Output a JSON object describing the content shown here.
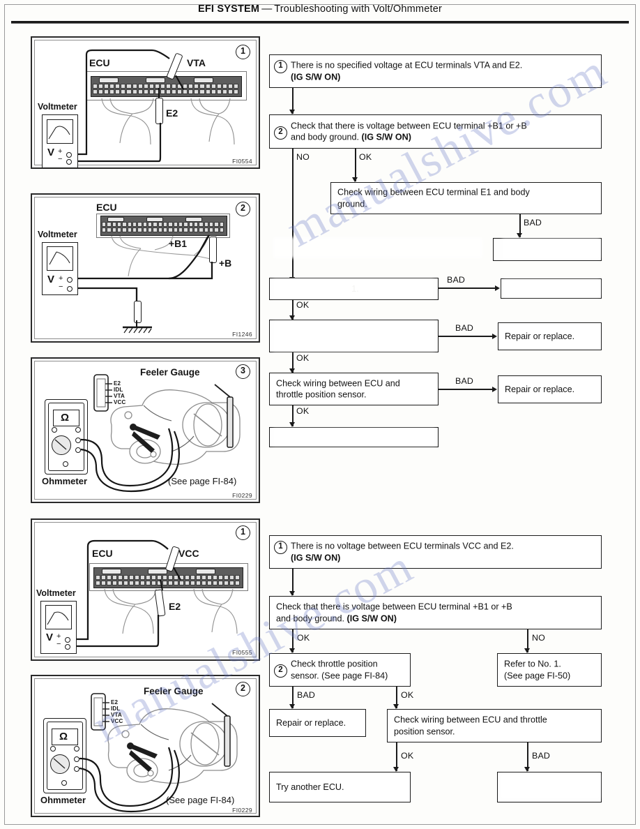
{
  "header": {
    "title_bold": "EFI SYSTEM",
    "dash": "—",
    "title_rest": "Troubleshooting with Volt/Ohmmeter",
    "page_number": ""
  },
  "watermark": {
    "line1": "manualshive.com",
    "line2": "manualshive.com"
  },
  "panels": [
    {
      "id": "panel-1",
      "number": "1",
      "fig_code": "FI0554",
      "labels": {
        "meter": "Voltmeter",
        "ecu": "ECU",
        "terminal_a": "VTA",
        "terminal_b": "E2",
        "meter_symbol": "V",
        "plus": "+",
        "minus": "−"
      }
    },
    {
      "id": "panel-2",
      "number": "2",
      "fig_code": "FI1246",
      "labels": {
        "meter": "Voltmeter",
        "ecu": "ECU",
        "terminal_a": "+B1",
        "terminal_b": "+B",
        "meter_symbol": "V",
        "plus": "+",
        "minus": "−"
      }
    },
    {
      "id": "panel-3",
      "number": "3",
      "fig_code": "FI0229",
      "labels": {
        "meter": "Ohmmeter",
        "tool": "Feeler Gauge",
        "reference": "(See page FI-84)",
        "meter_symbol": "Ω",
        "pins": [
          "E2",
          "IDL",
          "VTA",
          "VCC"
        ]
      }
    },
    {
      "id": "panel-4",
      "number": "1",
      "fig_code": "FI0555",
      "labels": {
        "meter": "Voltmeter",
        "ecu": "ECU",
        "terminal_a": "VCC",
        "terminal_b": "E2",
        "meter_symbol": "V",
        "plus": "+",
        "minus": "−"
      }
    },
    {
      "id": "panel-5",
      "number": "2",
      "fig_code": "FI0229",
      "labels": {
        "meter": "Ohmmeter",
        "tool": "Feeler Gauge",
        "reference": "(See page FI-84)",
        "meter_symbol": "Ω",
        "pins": [
          "E2",
          "IDL",
          "VTA",
          "VCC"
        ]
      }
    }
  ],
  "flowchart_top": {
    "step1": {
      "marker": "1",
      "line1": "There is no specified voltage at ECU terminals VTA and E2.",
      "line2_bold": "(IG S/W ON)"
    },
    "step2": {
      "marker": "2",
      "line1": "Check that there is voltage between ECU terminal +B1 or +B",
      "line2": "and body ground.",
      "line2_bold": "(IG S/W ON)"
    },
    "branch_no": "NO",
    "branch_ok": "OK",
    "box_e1_ground": {
      "line1": "Check wiring between ECU terminal E1 and body",
      "line2": "ground."
    },
    "label_bad_1": "BAD",
    "box_bad_1": "",
    "box_faded_1": "1.",
    "label_ok_1": "OK",
    "label_bad_2": "BAD",
    "box_bad_2": "",
    "box_faded_2": "",
    "label_ok_2": "OK",
    "label_bad_3": "BAD",
    "box_repair_1": "Repair or replace.",
    "label_ok_3": "OK",
    "box_check_wiring": {
      "line1": "Check wiring between ECU and",
      "line2": "throttle position sensor."
    },
    "label_bad_4": "BAD",
    "box_repair_2": "Repair or replace.",
    "label_ok_4": "OK",
    "box_final": ""
  },
  "flowchart_bottom": {
    "step1": {
      "marker": "1",
      "line1": "There is no voltage between ECU terminals VCC and E2.",
      "line2_bold": "(IG S/W ON)"
    },
    "step2": {
      "line1": "Check that there is voltage between ECU terminal +B1 or +B",
      "line2": "and body ground.",
      "line2_bold": "(IG S/W ON)"
    },
    "label_ok_1": "OK",
    "label_no_1": "NO",
    "box_tps": {
      "marker": "2",
      "line1": "Check throttle position",
      "line2": "sensor. (See page FI-84)"
    },
    "box_refer": {
      "line1": "Refer to No. 1.",
      "line2": "(See page FI-50)"
    },
    "label_bad_1": "BAD",
    "label_ok_2": "OK",
    "box_repair": "Repair or replace.",
    "box_check_wiring": {
      "line1": "Check wiring between ECU and throttle",
      "line2": "position sensor."
    },
    "label_ok_3": "OK",
    "label_bad_2": "BAD",
    "box_try_ecu": "Try another ECU.",
    "box_bad_final": ""
  }
}
